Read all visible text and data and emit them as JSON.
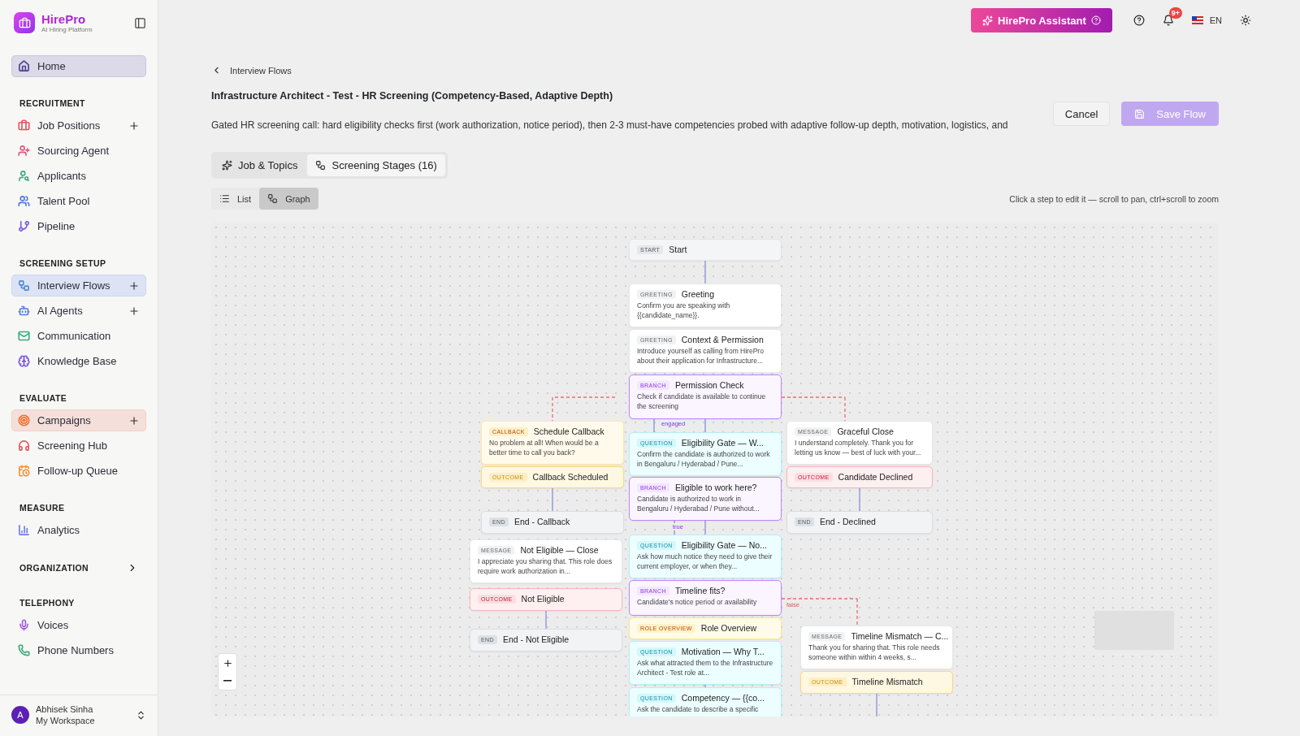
{
  "brand": {
    "name": "HirePro",
    "tagline": "AI Hiring Platform"
  },
  "sidebar": {
    "home": {
      "label": "Home",
      "selected": true,
      "color": "#4c3f8f"
    },
    "sections": [
      {
        "title": "RECRUITMENT",
        "items": [
          {
            "label": "Job Positions",
            "selected": false,
            "addable": true,
            "color": "#e0565b"
          },
          {
            "label": "Sourcing Agent",
            "selected": false,
            "addable": false,
            "color": "#e4577e"
          },
          {
            "label": "Applicants",
            "selected": false,
            "addable": false,
            "color": "#3bab7d"
          },
          {
            "label": "Talent Pool",
            "selected": false,
            "addable": false,
            "color": "#4f7be0"
          },
          {
            "label": "Pipeline",
            "selected": false,
            "addable": false,
            "color": "#7a5ae0"
          }
        ]
      },
      {
        "title": "SCREENING SETUP",
        "items": [
          {
            "label": "Interview Flows",
            "selected": true,
            "addable": true,
            "color": "#4f88d8"
          },
          {
            "label": "AI Agents",
            "selected": false,
            "addable": true,
            "color": "#4f7be0"
          },
          {
            "label": "Communication",
            "selected": false,
            "addable": false,
            "color": "#3bab7d"
          },
          {
            "label": "Knowledge Base",
            "selected": false,
            "addable": false,
            "color": "#7a5ae0"
          }
        ]
      },
      {
        "title": "EVALUATE",
        "items": [
          {
            "label": "Campaigns",
            "selected": true,
            "addable": true,
            "color": "#f26b2a"
          },
          {
            "label": "Screening Hub",
            "selected": false,
            "addable": false,
            "color": "#e0565b"
          },
          {
            "label": "Follow-up Queue",
            "selected": false,
            "addable": false,
            "color": "#f0902a"
          }
        ]
      },
      {
        "title": "MEASURE",
        "items": [
          {
            "label": "Analytics",
            "selected": false,
            "addable": false,
            "color": "#6b7fe0"
          }
        ]
      },
      {
        "title": "ORGANIZATION",
        "expanded": false
      },
      {
        "title": "TELEPHONY",
        "items": [
          {
            "label": "Voices",
            "selected": false,
            "addable": false,
            "color": "#a35ae0"
          },
          {
            "label": "Phone Numbers",
            "selected": false,
            "addable": false,
            "color": "#3bab7d"
          }
        ]
      }
    ],
    "user": {
      "initial": "A",
      "name": "Abhisek Sinha",
      "workspace": "My Workspace"
    }
  },
  "topbar": {
    "assistant": "HirePro Assistant",
    "notifications": "9+",
    "language": "EN"
  },
  "page": {
    "back": "Interview Flows",
    "title": "Infrastructure Architect - Test - HR Screening (Competency-Based, Adaptive Depth)",
    "description": "Gated HR screening call: hard eligibility checks first (work authorization, notice period), then 2-3 must-have competencies probed with adaptive follow-up depth, motivation, logistics, and",
    "cancel": "Cancel",
    "save": {
      "label": "Save Flow",
      "disabled": true
    }
  },
  "tabs": [
    {
      "label": "Job & Topics",
      "selected": false
    },
    {
      "label": "Screening Stages (16)",
      "selected": true
    }
  ],
  "views": [
    {
      "label": "List",
      "selected": false
    },
    {
      "label": "Graph",
      "selected": true
    }
  ],
  "hint": "Click a step to edit it — scroll to pan, ctrl+scroll to zoom",
  "graph": {
    "nodes": [
      {
        "kind": "start",
        "tag": "START",
        "title": "Start"
      },
      {
        "kind": "greeting",
        "tag": "GREETING",
        "title": "Greeting",
        "text": "Confirm you are speaking with {{candidate_name}}."
      },
      {
        "kind": "greeting",
        "tag": "GREETING",
        "title": "Context & Permission",
        "text": "Introduce yourself as calling from HirePro about their application for Infrastructure..."
      },
      {
        "kind": "branch",
        "tag": "BRANCH",
        "title": "Permission Check",
        "text": "Check if candidate is available to continue the screening"
      },
      {
        "kind": "callback",
        "tag": "CALLBACK",
        "title": "Schedule Callback",
        "text": "No problem at all! When would be a better time to call you back?"
      },
      {
        "kind": "question",
        "tag": "QUESTION",
        "title": "Eligibility Gate — W...",
        "text": "Confirm the candidate is authorized to work in Bengaluru / Hyderabad / Pune..."
      },
      {
        "kind": "message",
        "tag": "MESSAGE",
        "title": "Graceful Close",
        "text": "I understand completely. Thank you for letting us know — best of luck with your..."
      },
      {
        "kind": "outcome",
        "tag": "OUTCOME",
        "title": "Callback Scheduled",
        "color": "#fcd97a"
      },
      {
        "kind": "outcome",
        "tag": "OUTCOME",
        "title": "Candidate Declined",
        "color": "#f9b4bd"
      },
      {
        "kind": "branch",
        "tag": "BRANCH",
        "title": "Eligible to work here?",
        "text": "Candidate is authorized to work in Bengaluru / Hyderabad / Pune without..."
      },
      {
        "kind": "end",
        "tag": "END",
        "title": "End - Callback"
      },
      {
        "kind": "end",
        "tag": "END",
        "title": "End - Declined"
      },
      {
        "kind": "message",
        "tag": "MESSAGE",
        "title": "Not Eligible — Close",
        "text": "I appreciate you sharing that. This role does require work authorization in..."
      },
      {
        "kind": "outcome",
        "tag": "OUTCOME",
        "title": "Not Eligible",
        "color": "#f9b4bd"
      },
      {
        "kind": "end",
        "tag": "END",
        "title": "End - Not Eligible"
      },
      {
        "kind": "question",
        "tag": "QUESTION",
        "title": "Eligibility Gate — No...",
        "text": "Ask how much notice they need to give their current employer, or when they..."
      },
      {
        "kind": "branch",
        "tag": "BRANCH",
        "title": "Timeline fits?",
        "text": "Candidate's notice period or availability"
      },
      {
        "kind": "role_overview",
        "tag": "ROLE OVERVIEW",
        "title": "Role Overview"
      },
      {
        "kind": "question",
        "tag": "QUESTION",
        "title": "Motivation — Why T...",
        "text": "Ask what attracted them to the Infrastructure Architect - Test role at..."
      },
      {
        "kind": "message",
        "tag": "MESSAGE",
        "title": "Timeline Mismatch — C...",
        "text": "Thank you for sharing that. This role needs someone within within 4 weeks, s..."
      },
      {
        "kind": "outcome",
        "tag": "OUTCOME",
        "title": "Timeline Mismatch",
        "color": "#fcd97a"
      },
      {
        "kind": "question",
        "tag": "QUESTION",
        "title": "Competency — {{co...",
        "text": "Ask the candidate to describe a specific"
      }
    ],
    "edge_labels": [
      "engaged",
      "true",
      "false"
    ]
  }
}
